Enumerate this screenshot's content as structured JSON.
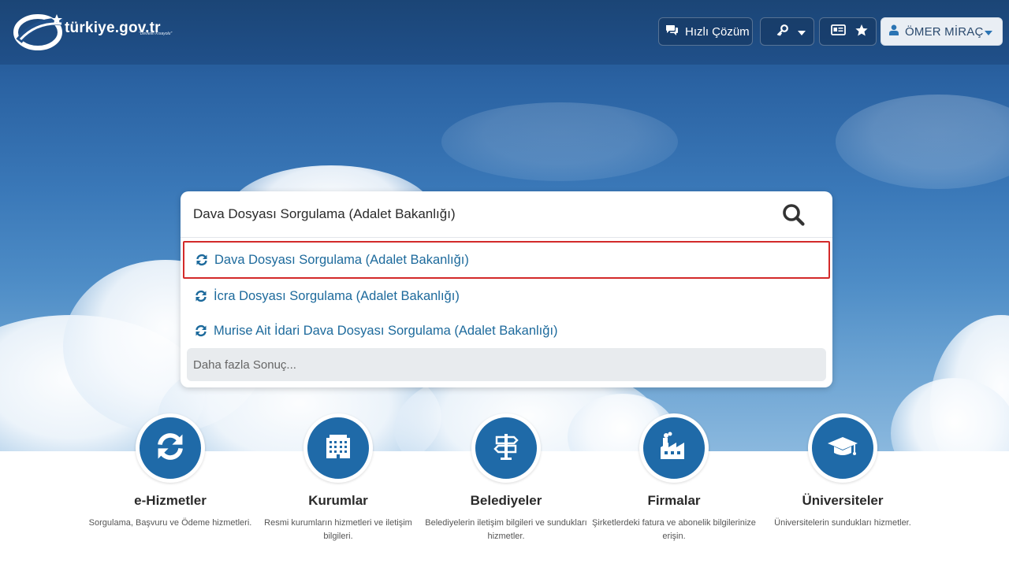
{
  "header": {
    "logo_text": "türkiye.gov.tr",
    "logo_slogan": "\"Devletin Kısayolu\"",
    "quick_solution_label": "Hızlı Çözüm",
    "user_name": "ÖMER MİRAÇ"
  },
  "search": {
    "value": "Dava Dosyası Sorgulama (Adalet Bakanlığı)",
    "results": [
      "Dava Dosyası Sorgulama (Adalet Bakanlığı)",
      "İcra Dosyası Sorgulama (Adalet Bakanlığı)",
      "Murise Ait İdari Dava Dosyası Sorgulama (Adalet Bakanlığı)"
    ],
    "more_label": "Daha fazla Sonuç..."
  },
  "categories": [
    {
      "title": "e-Hizmetler",
      "desc": "Sorgulama, Başvuru ve Ödeme hizmetleri."
    },
    {
      "title": "Kurumlar",
      "desc": "Resmi kurumların hizmetleri ve iletişim bilgileri."
    },
    {
      "title": "Belediyeler",
      "desc": "Belediyelerin iletişim bilgileri ve sundukları hizmetler."
    },
    {
      "title": "Firmalar",
      "desc": "Şirketlerdeki fatura ve abonelik bilgilerinize erişin."
    },
    {
      "title": "Üniversiteler",
      "desc": "Üniversitelerin sundukları hizmetler."
    }
  ],
  "colors": {
    "brand_blue": "#1f6aa8",
    "link_blue": "#1d6a9c",
    "highlight_red": "#d32a2a"
  }
}
